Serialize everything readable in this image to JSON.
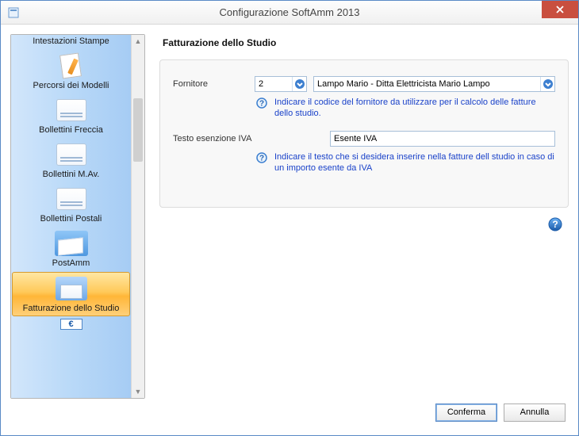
{
  "window": {
    "title": "Configurazione SoftAmm 2013"
  },
  "sidebar": {
    "items": [
      {
        "label": "Intestazioni Stampe",
        "icon": "documents-icon"
      },
      {
        "label": "Percorsi dei Modelli",
        "icon": "pencil-icon"
      },
      {
        "label": "Bollettini Freccia",
        "icon": "slip-icon"
      },
      {
        "label": "Bollettini M.Av.",
        "icon": "slip-icon"
      },
      {
        "label": "Bollettini Postali",
        "icon": "slip-icon"
      },
      {
        "label": "PostAmm",
        "icon": "postamm-icon"
      },
      {
        "label": "Fatturazione dello Studio",
        "icon": "invoice-icon",
        "selected": true
      },
      {
        "label": "",
        "icon": "euro-icon"
      }
    ]
  },
  "main": {
    "title": "Fatturazione dello Studio",
    "fornitore_label": "Fornitore",
    "fornitore_code": "2",
    "fornitore_name": "Lampo Mario - Ditta Elettricista Mario Lampo",
    "fornitore_help": "Indicare il codice del fornitore da utilizzare per il calcolo delle fatture dello studio.",
    "esenzione_label": "Testo esenzione IVA",
    "esenzione_value": "Esente IVA",
    "esenzione_help": "Indicare il testo che si desidera inserire nella fatture dell studio in caso di un importo esente da IVA"
  },
  "footer": {
    "confirm": "Conferma",
    "cancel": "Annulla"
  }
}
